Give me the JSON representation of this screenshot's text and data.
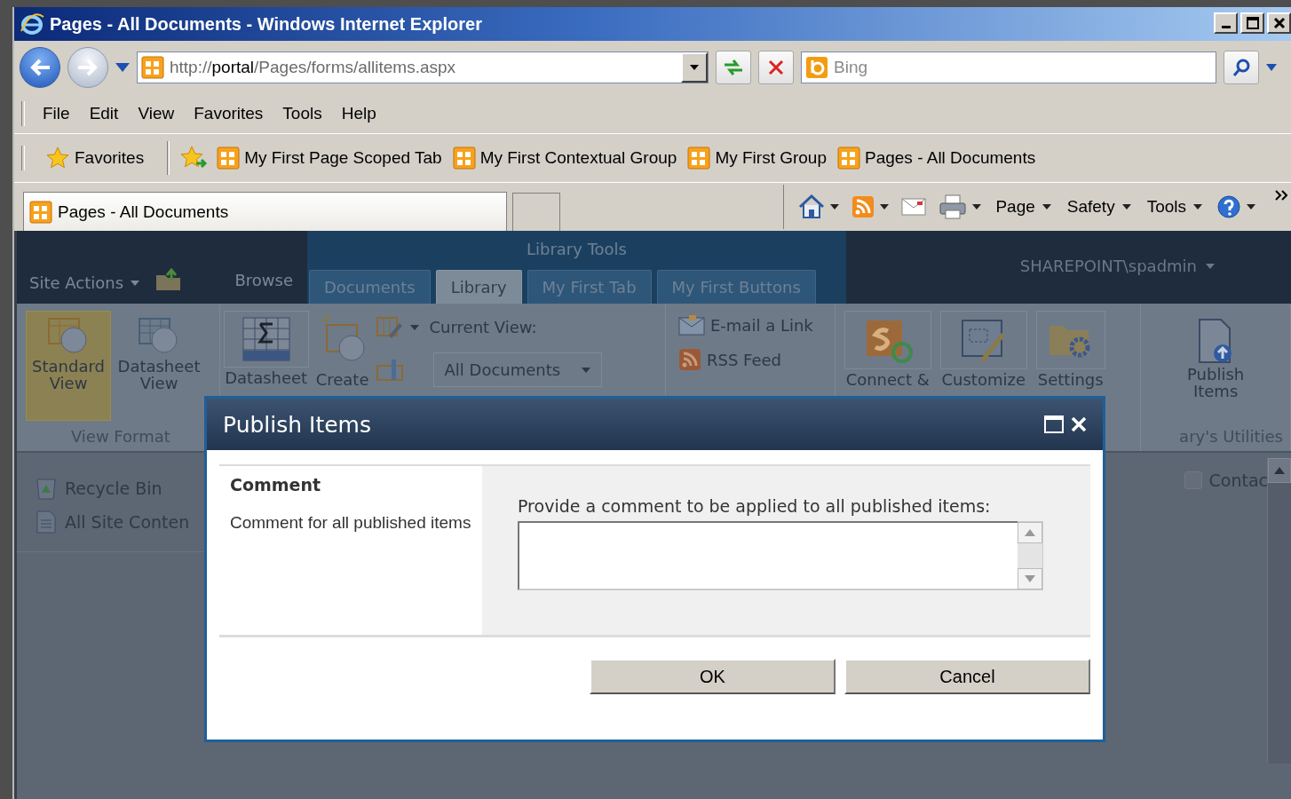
{
  "window": {
    "title": "Pages - All Documents - Windows Internet Explorer"
  },
  "address_bar": {
    "scheme": "http://",
    "host": "portal",
    "path": "/Pages/forms/allitems.aspx"
  },
  "search": {
    "placeholder": "Bing"
  },
  "menu": [
    "File",
    "Edit",
    "View",
    "Favorites",
    "Tools",
    "Help"
  ],
  "favorites_bar": {
    "button": "Favorites",
    "links": [
      "My First Page Scoped Tab",
      "My First Contextual Group",
      "My First Group",
      "Pages - All Documents"
    ]
  },
  "tabs": [
    {
      "label": "Pages - All Documents",
      "selected": true
    }
  ],
  "command_bar": [
    "Page",
    "Safety",
    "Tools"
  ],
  "sharepoint": {
    "site_actions": "Site Actions",
    "contextual_group": "Library Tools",
    "user": "SHAREPOINT\\spadmin",
    "tabs": [
      {
        "label": "Browse",
        "selected": false,
        "contextual": false
      },
      {
        "label": "Documents",
        "selected": false,
        "contextual": true
      },
      {
        "label": "Library",
        "selected": true,
        "contextual": true
      },
      {
        "label": "My First Tab",
        "selected": false,
        "contextual": true
      },
      {
        "label": "My First Buttons",
        "selected": false,
        "contextual": true
      }
    ],
    "ribbon": {
      "view_format": {
        "label": "View Format",
        "buttons": [
          {
            "label": "Standard View",
            "selected": true
          },
          {
            "label": "Datasheet View",
            "selected": false
          }
        ]
      },
      "datasheet": "Datasheet",
      "create": "Create",
      "current_view_label": "Current View:",
      "current_view_value": "All Documents",
      "share_links": [
        "E-mail a Link",
        "RSS Feed"
      ],
      "connect_buttons": [
        "Connect &",
        "Customize",
        "Settings"
      ],
      "publish": "Publish Items",
      "utilities_label": "ary's Utilities"
    },
    "quick_launch": [
      "Recycle Bin",
      "All Site Conten"
    ],
    "list_checkbox": {
      "label": "Contac",
      "checked": false
    }
  },
  "dialog": {
    "title": "Publish Items",
    "section_title": "Comment",
    "section_description": "Comment for all published items",
    "field_label": "Provide a comment to be applied to all published items:",
    "buttons": [
      "OK",
      "Cancel"
    ]
  }
}
